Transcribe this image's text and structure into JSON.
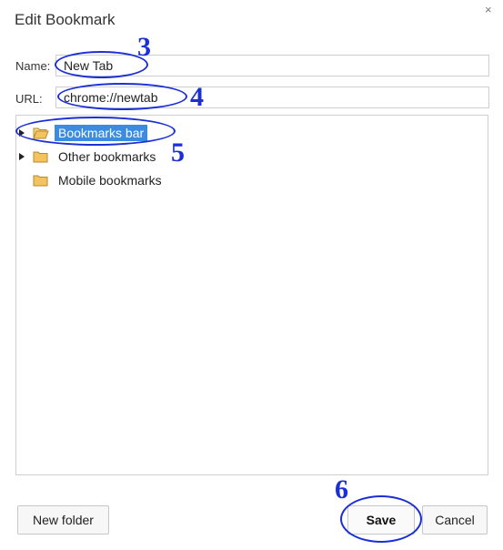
{
  "dialog": {
    "title": "Edit Bookmark",
    "close_glyph": "×"
  },
  "form": {
    "name_label": "Name:",
    "name_value": "New Tab",
    "url_label": "URL:",
    "url_value": "chrome://newtab"
  },
  "tree": {
    "items": [
      {
        "label": "Bookmarks bar",
        "expandable": true,
        "selected": true,
        "icon": "folder-open-icon"
      },
      {
        "label": "Other bookmarks",
        "expandable": true,
        "selected": false,
        "icon": "folder-icon"
      },
      {
        "label": "Mobile bookmarks",
        "expandable": false,
        "selected": false,
        "icon": "folder-icon"
      }
    ]
  },
  "buttons": {
    "new_folder": "New folder",
    "save": "Save",
    "cancel": "Cancel"
  },
  "annotations": {
    "name": "3",
    "url": "4",
    "tree": "5",
    "save": "6",
    "color": "#1a2fd6"
  },
  "colors": {
    "selection": "#3b8be0",
    "folder": "#f3c35e"
  }
}
